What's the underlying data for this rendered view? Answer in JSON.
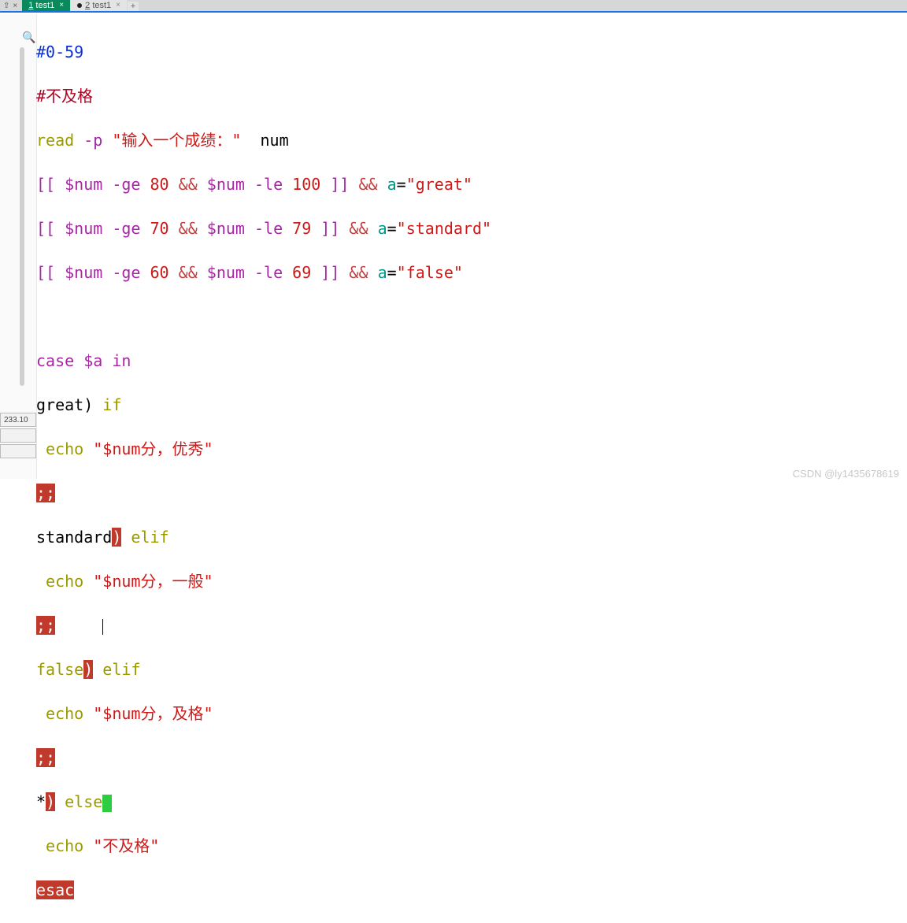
{
  "toolbar": {
    "pin": "⇧",
    "close": "×"
  },
  "tabs": {
    "active": {
      "index_label": "1",
      "name": "test1",
      "close": "×"
    },
    "inactive": {
      "index_label": "2",
      "name": "test1",
      "close": "×"
    },
    "add": "+"
  },
  "search_icon": "🔍",
  "status": {
    "row1": "233.10",
    "row2": "",
    "row3": ""
  },
  "watermark": "CSDN @ly1435678619",
  "code": {
    "l1": {
      "a": "#0-59"
    },
    "l2": {
      "a": "#不及格"
    },
    "l3": {
      "a": "read",
      "b": " -p ",
      "c": "\"输入一个成绩：\"",
      "d": "  num"
    },
    "l4": {
      "a": "[[",
      "b": " $num ",
      "c": "-ge ",
      "d": "80",
      "e": " && ",
      "f": "$num ",
      "g": "-le ",
      "h": "100",
      "i": " ]]",
      "j": " && ",
      "k": "a",
      "l": "=",
      "m": "\"great\""
    },
    "l5": {
      "a": "[[",
      "b": " $num ",
      "c": "-ge ",
      "d": "70",
      "e": " && ",
      "f": "$num ",
      "g": "-le ",
      "h": "79",
      "i": " ]]",
      "j": " && ",
      "k": "a",
      "l": "=",
      "m": "\"standard\""
    },
    "l6": {
      "a": "[[",
      "b": " $num ",
      "c": "-ge ",
      "d": "60",
      "e": " && ",
      "f": "$num ",
      "g": "-le ",
      "h": "69",
      "i": " ]]",
      "j": " && ",
      "k": "a",
      "l": "=",
      "m": "\"false\""
    },
    "l8": {
      "a": "case",
      "b": " $a ",
      "c": "in"
    },
    "l9": {
      "a": "great",
      "b": ")",
      "c": " if"
    },
    "l10": {
      "a": " echo ",
      "b": "\"$num分，优秀\""
    },
    "l11": {
      "a": ";;"
    },
    "l12": {
      "a": "standard",
      "b": ")",
      "c": " elif"
    },
    "l13": {
      "a": " echo ",
      "b": "\"$num分，一般\""
    },
    "l14": {
      "a": ";;"
    },
    "l15": {
      "a": "false",
      "b": ")",
      "c": " elif"
    },
    "l16": {
      "a": " echo ",
      "b": "\"$num分，及格\""
    },
    "l17": {
      "a": ";;"
    },
    "l18": {
      "a": "*",
      "b": ")",
      "c": " else"
    },
    "l19": {
      "a": " echo ",
      "b": "\"不及格\""
    },
    "l20": {
      "a": "esac"
    }
  }
}
